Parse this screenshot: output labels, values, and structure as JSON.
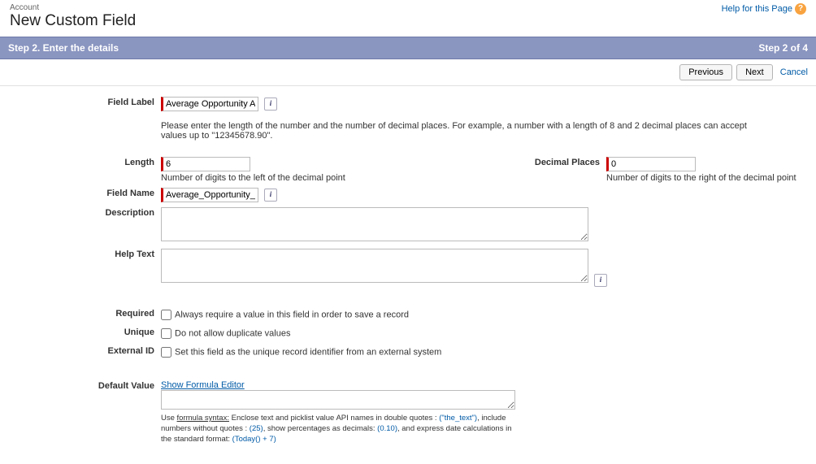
{
  "header": {
    "crumb": "Account",
    "title": "New Custom Field",
    "help_label": "Help for this Page"
  },
  "step": {
    "left": "Step 2. Enter the details",
    "right": "Step 2 of 4"
  },
  "buttons": {
    "previous": "Previous",
    "next": "Next",
    "cancel": "Cancel"
  },
  "labels": {
    "field_label": "Field Label",
    "length": "Length",
    "decimal_places": "Decimal Places",
    "field_name": "Field Name",
    "description": "Description",
    "help_text": "Help Text",
    "required": "Required",
    "unique": "Unique",
    "external_id": "External ID",
    "default_value": "Default Value"
  },
  "values": {
    "field_label": "Average Opportunity A",
    "length": "6",
    "decimal_places": "0",
    "field_name": "Average_Opportunity_",
    "description": "",
    "help_text": "",
    "default_formula": ""
  },
  "instructions": {
    "number_help": "Please enter the length of the number and the number of decimal places. For example, a number with a length of 8 and 2 decimal places can accept values up to \"12345678.90\".",
    "length_sub": "Number of digits to the left of the decimal point",
    "decimal_sub": "Number of digits to the right of the decimal point"
  },
  "checks": {
    "required": "Always require a value in this field in order to save a record",
    "unique": "Do not allow duplicate values",
    "external": "Set this field as the unique record identifier from an external system"
  },
  "formula": {
    "show": "Show Formula Editor",
    "help_prefix": "Use ",
    "help_link": "formula syntax:",
    "help_body": " Enclose text and picklist value API names in double quotes : ",
    "ex_text": "(\"the_text\")",
    "help_body2": ", include numbers without quotes : ",
    "ex_num": "(25)",
    "help_body3": ", show percentages as decimals: ",
    "ex_pct": "(0.10)",
    "help_body4": ", and express date calculations in the standard format: ",
    "ex_date": "(Today() + 7)"
  }
}
